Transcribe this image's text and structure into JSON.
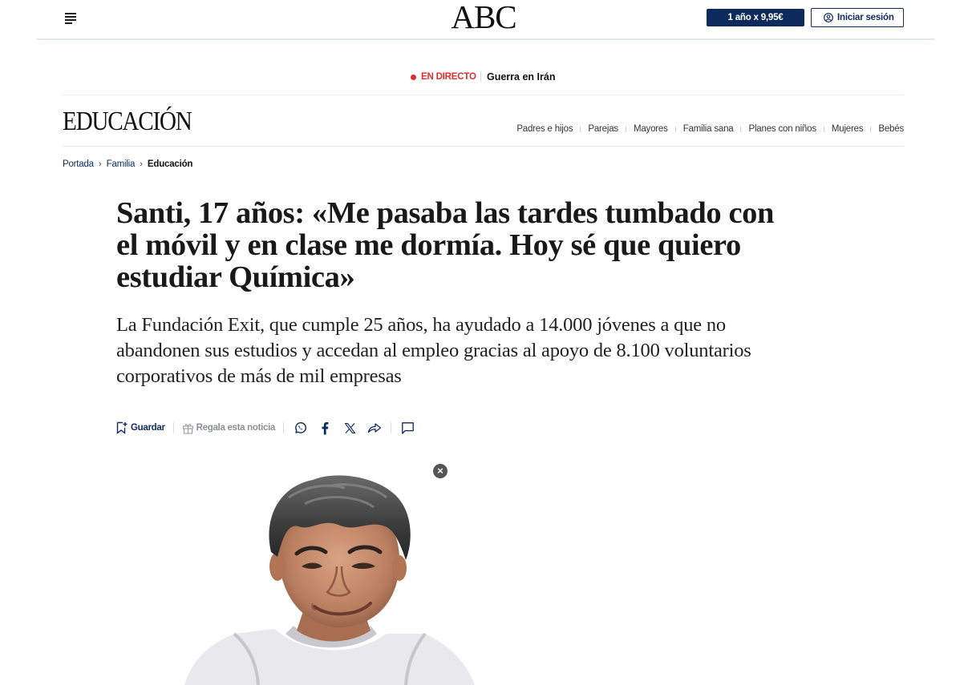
{
  "header": {
    "logo": "ABC",
    "subscribe_label": "1 año x 9,95€",
    "login_label": "Iniciar sesión"
  },
  "live": {
    "label": "EN DIRECTO",
    "topic": "Guerra en Irán"
  },
  "section": {
    "title": "EDUCACIÓN",
    "nav": [
      "Padres e hijos",
      "Parejas",
      "Mayores",
      "Familia sana",
      "Planes con niños",
      "Mujeres",
      "Bebés"
    ]
  },
  "breadcrumb": {
    "items": [
      "Portada",
      "Familia"
    ],
    "current": "Educación"
  },
  "article": {
    "headline": "Santi, 17 años: «Me pasaba las tardes tumbado con el móvil y en clase me dormía. Hoy sé que quiero estudiar Química»",
    "subhead": "La Fundación Exit, que cumple 25 años, ha ayudado a 14.000 jóvenes a que no abandonen sus estudios y accedan al empleo gracias al apoyo de 8.100 voluntarios corporativos de más de mil empresas"
  },
  "actions": {
    "save_label": "Guardar",
    "gift_label": "Regala esta noticia",
    "icons": [
      "bookmark-icon",
      "gift-icon",
      "whatsapp-icon",
      "facebook-icon",
      "x-icon",
      "share-icon",
      "comment-icon"
    ]
  },
  "colors": {
    "brand_navy": "#0d2a5c",
    "live_red": "#e02d2d"
  }
}
